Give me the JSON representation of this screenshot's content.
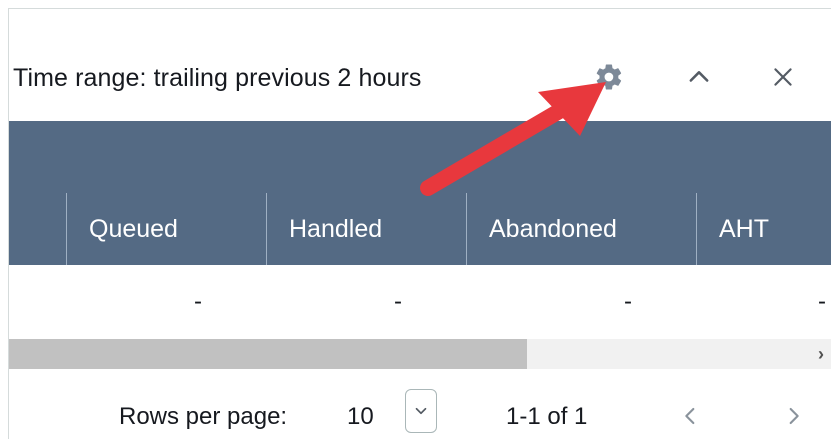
{
  "header": {
    "time_range": "Time range: trailing previous 2 hours",
    "icons": {
      "settings": "gear-icon",
      "collapse": "chevron-up-icon",
      "close": "close-icon"
    }
  },
  "table": {
    "columns": [
      "Queued",
      "Handled",
      "Abandoned",
      "AHT"
    ],
    "row": [
      "-",
      "-",
      "-",
      "-"
    ]
  },
  "pagination": {
    "rows_per_page_label": "Rows per page:",
    "rows_per_page_value": "10",
    "range_text": "1-1 of 1"
  },
  "colors": {
    "header_bg": "#546a84",
    "arrow": "#e8383d"
  }
}
